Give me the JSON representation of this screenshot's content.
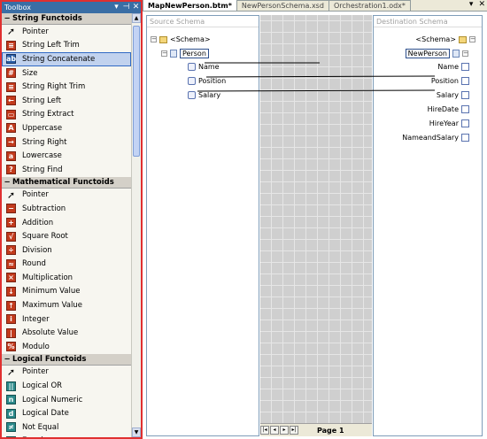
{
  "toolbox": {
    "title": "Toolbox",
    "categories": [
      {
        "label": "String Functoids",
        "items": [
          {
            "label": "Pointer",
            "icon": "pointer-icon"
          },
          {
            "label": "String Left Trim",
            "icon": "string-left-trim-icon"
          },
          {
            "label": "String Concatenate",
            "icon": "string-concatenate-icon",
            "selected": true
          },
          {
            "label": "Size",
            "icon": "size-icon"
          },
          {
            "label": "String Right Trim",
            "icon": "string-right-trim-icon"
          },
          {
            "label": "String Left",
            "icon": "string-left-icon"
          },
          {
            "label": "String Extract",
            "icon": "string-extract-icon"
          },
          {
            "label": "Uppercase",
            "icon": "uppercase-icon"
          },
          {
            "label": "String Right",
            "icon": "string-right-icon"
          },
          {
            "label": "Lowercase",
            "icon": "lowercase-icon"
          },
          {
            "label": "String Find",
            "icon": "string-find-icon"
          }
        ]
      },
      {
        "label": "Mathematical Functoids",
        "items": [
          {
            "label": "Pointer",
            "icon": "pointer-icon"
          },
          {
            "label": "Subtraction",
            "icon": "subtraction-icon"
          },
          {
            "label": "Addition",
            "icon": "addition-icon"
          },
          {
            "label": "Square Root",
            "icon": "square-root-icon"
          },
          {
            "label": "Division",
            "icon": "division-icon"
          },
          {
            "label": "Round",
            "icon": "round-icon"
          },
          {
            "label": "Multiplication",
            "icon": "multiplication-icon"
          },
          {
            "label": "Minimum Value",
            "icon": "minimum-value-icon"
          },
          {
            "label": "Maximum Value",
            "icon": "maximum-value-icon"
          },
          {
            "label": "Integer",
            "icon": "integer-icon"
          },
          {
            "label": "Absolute Value",
            "icon": "absolute-value-icon"
          },
          {
            "label": "Modulo",
            "icon": "modulo-icon"
          }
        ]
      },
      {
        "label": "Logical Functoids",
        "items": [
          {
            "label": "Pointer",
            "icon": "pointer-icon"
          },
          {
            "label": "Logical OR",
            "icon": "logical-or-icon"
          },
          {
            "label": "Logical Numeric",
            "icon": "logical-numeric-icon"
          },
          {
            "label": "Logical Date",
            "icon": "logical-date-icon"
          },
          {
            "label": "Not Equal",
            "icon": "not-equal-icon"
          },
          {
            "label": "Equal",
            "icon": "equal-icon"
          }
        ]
      }
    ]
  },
  "tabs": [
    {
      "label": "MapNewPerson.btm*",
      "active": true
    },
    {
      "label": "NewPersonSchema.xsd",
      "active": false
    },
    {
      "label": "Orchestration1.odx*",
      "active": false
    }
  ],
  "source_schema": {
    "title": "Source Schema",
    "root": "<Schema>",
    "record": "Person",
    "fields": [
      "Name",
      "Position",
      "Salary"
    ]
  },
  "destination_schema": {
    "title": "Destination Schema",
    "root": "<Schema>",
    "record": "NewPerson",
    "fields": [
      "Name",
      "Position",
      "Salary",
      "HireDate",
      "HireYear",
      "NameandSalary"
    ]
  },
  "grid": {
    "page_tab": "Page 1"
  },
  "colors": {
    "selection": "#c1d2ee",
    "accent": "#3a6ea5",
    "highlight": "#e03030"
  }
}
